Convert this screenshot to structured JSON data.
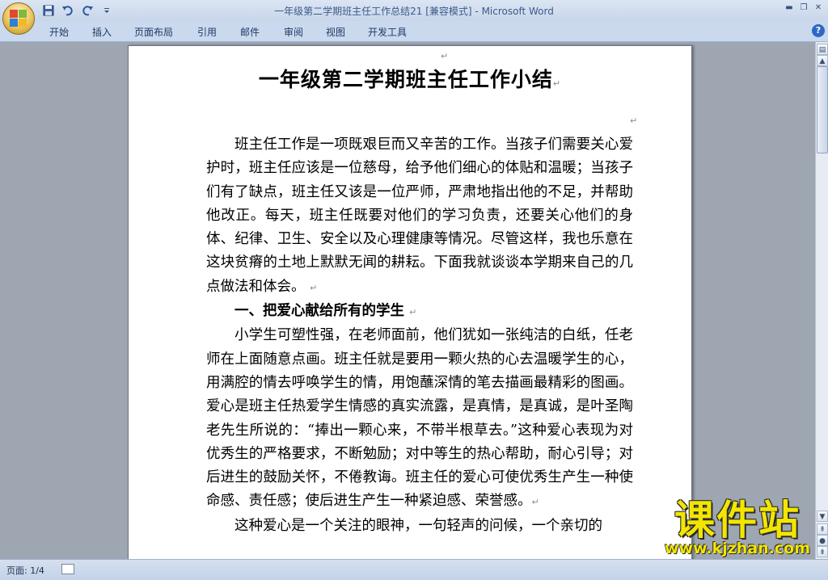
{
  "window": {
    "title": "一年级第二学期班主任工作总结21 [兼容模式]",
    "separator": " - ",
    "app_name": "Microsoft Word"
  },
  "quick_access": {
    "icons": [
      "save-icon",
      "undo-icon",
      "redo-icon",
      "customize-icon"
    ]
  },
  "ribbon": {
    "tabs": [
      "开始",
      "插入",
      "页面布局",
      "引用",
      "邮件",
      "审阅",
      "视图",
      "开发工具"
    ],
    "help_label": "?"
  },
  "document": {
    "title": "一年级第二学期班主任工作小结",
    "paragraph_mark": "↵",
    "paragraphs": [
      "班主任工作是一项既艰巨而又辛苦的工作。当孩子们需要关心爱护时，班主任应该是一位慈母，给予他们细心的体贴和温暖；当孩子们有了缺点，班主任又该是一位严师，严肃地指出他的不足，并帮助他改正。每天，班主任既要对他们的学习负责，还要关心他们的身体、纪律、卫生、安全以及心理健康等情况。尽管这样，我也乐意在这块贫瘠的土地上默默无闻的耕耘。下面我就谈谈本学期来自己的几点做法和体会。",
      "一、把爱心献给所有的学生",
      "小学生可塑性强，在老师面前，他们犹如一张纯洁的白纸，任老师在上面随意点画。班主任就是要用一颗火热的心去温暖学生的心，用满腔的情去呼唤学生的情，用饱蘸深情的笔去描画最精彩的图画。爱心是班主任热爱学生情感的真实流露，是真情，是真诚，是叶圣陶老先生所说的：“捧出一颗心来，不带半根草去。”这种爱心表现为对优秀生的严格要求，不断勉励；对中等生的热心帮助，耐心引导；对后进生的鼓励关怀，不倦教诲。班主任的爱心可使优秀生产生一种使命感、责任感；使后进生产生一种紧迫感、荣誉感。",
      "这种爱心是一个关注的眼神，一句轻声的问候，一个亲切的"
    ]
  },
  "statusbar": {
    "page": "页面: 1/4"
  },
  "watermark": {
    "text": "课件站",
    "url": "www.kjzhan.com"
  },
  "colors": {
    "title_text": "#3d5a8a",
    "workspace": "#9ea6b2",
    "watermark": "#f3e500"
  }
}
